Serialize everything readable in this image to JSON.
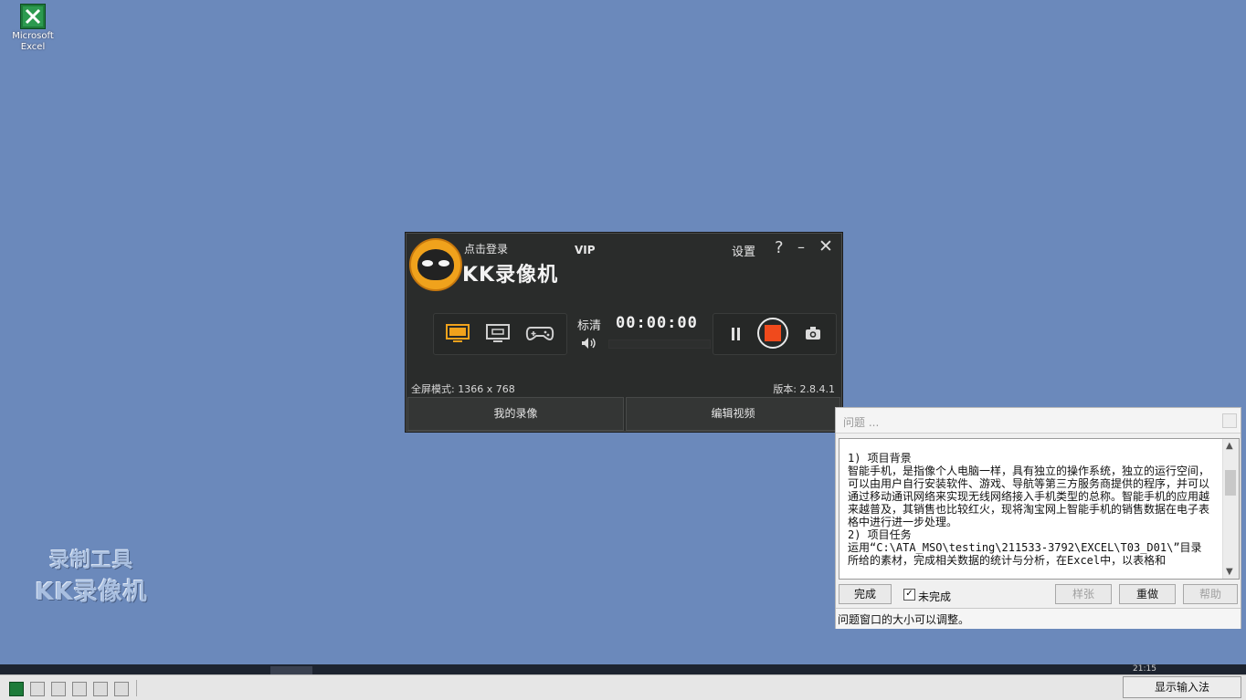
{
  "desktop": {
    "icon_label_line1": "Microsoft",
    "icon_label_line2": "Excel",
    "watermark_line1": "录制工具",
    "watermark_line2": "KK录像机"
  },
  "recorder": {
    "login": "点击登录",
    "vip": "VIP",
    "app_name": "KK录像机",
    "settings": "设置",
    "help": "?",
    "minimize": "–",
    "close": "✕",
    "quality": "标清",
    "timer": "00:00:00",
    "fullscreen_mode": "全屏模式: 1366 x 768",
    "version": "版本: 2.8.4.1",
    "my_recordings": "我的录像",
    "edit_video": "编辑视频",
    "icons": [
      "screen-icon",
      "window-icon",
      "gamepad-icon",
      "volume-icon",
      "pause-icon",
      "record-stop-icon",
      "camera-icon"
    ],
    "accent_color": "#f04a1c"
  },
  "question": {
    "title": "问题 ...",
    "lines": [
      "1) 项目背景",
      "智能手机，是指像个人电脑一样，具有独立的操作系统，独立的运行空间，可以由用户自行安装软件、游戏、导航等第三方服务商提供的程序，并可以通过移动通讯网络来实现无线网络接入手机类型的总称。智能手机的应用越来越普及，其销售也比较红火，现将淘宝网上智能手机的销售数据在电子表格中进行进一步处理。",
      "2) 项目任务",
      "运用“C:\\ATA_MSO\\testing\\211533-3792\\EXCEL\\T03_D01\\”目录所给的素材，完成相关数据的统计与分析，在Excel中，以表格和"
    ],
    "done_button": "完成",
    "unfinished_label": "未完成",
    "unfinished_checked": "✓",
    "sample_button": "样张",
    "redo_button": "重做",
    "help_button": "帮助",
    "hint": "问题窗口的大小可以调整。"
  },
  "taskbar": {
    "clock": "21:15",
    "ime_button": "显示输入法",
    "icons": [
      "excel-icon",
      "word-icon",
      "app-icon",
      "app-icon",
      "pen-icon",
      "tool-icon"
    ]
  }
}
